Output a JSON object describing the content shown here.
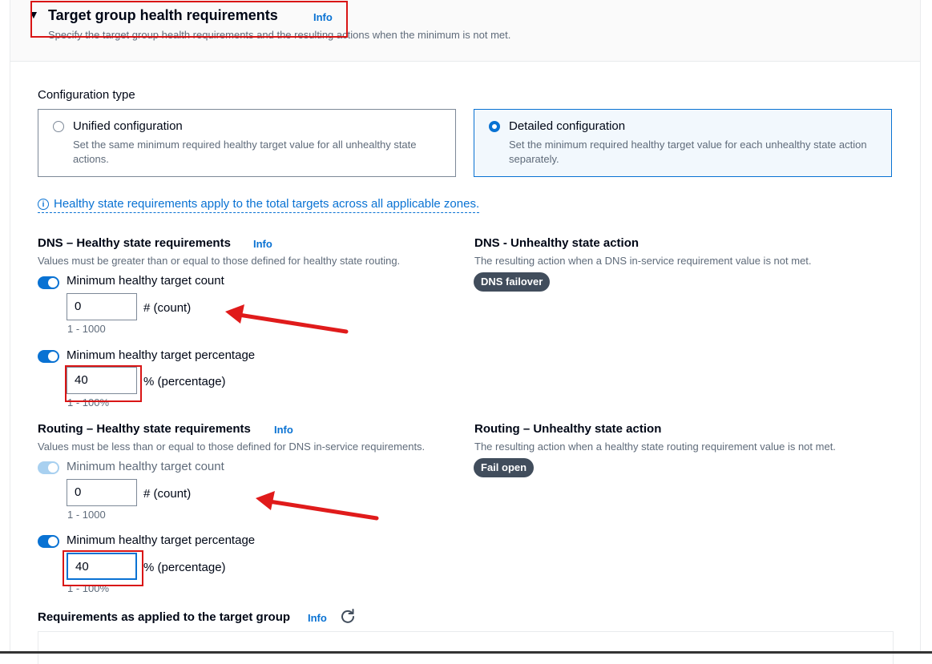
{
  "section": {
    "title": "Target group health requirements",
    "info": "Info",
    "description": "Specify the target group health requirements and the resulting actions when the minimum is not met."
  },
  "config_type": {
    "label": "Configuration type",
    "options": [
      {
        "title": "Unified configuration",
        "description": "Set the same minimum required healthy target value for all unhealthy state actions.",
        "selected": false
      },
      {
        "title": "Detailed configuration",
        "description": "Set the minimum required healthy target value for each unhealthy state action separately.",
        "selected": true
      }
    ]
  },
  "notice": "Healthy state requirements apply to the total targets across all applicable zones.",
  "dns": {
    "title": "DNS – Healthy state requirements",
    "info": "Info",
    "description": "Values must be greater than or equal to those defined for healthy state routing.",
    "count_label": "Minimum healthy target count",
    "count_value": "0",
    "count_unit": "# (count)",
    "count_constraint": "1 - 1000",
    "pct_label": "Minimum healthy target percentage",
    "pct_value": "40",
    "pct_unit": "% (percentage)",
    "pct_constraint": "1 - 100%",
    "action_title": "DNS - Unhealthy state action",
    "action_description": "The resulting action when a DNS in-service requirement value is not met.",
    "action_badge": "DNS failover"
  },
  "routing": {
    "title": "Routing – Healthy state requirements",
    "info": "Info",
    "description": "Values must be less than or equal to those defined for DNS in-service requirements.",
    "count_label": "Minimum healthy target count",
    "count_value": "0",
    "count_unit": "# (count)",
    "count_constraint": "1 - 1000",
    "pct_label": "Minimum healthy target percentage",
    "pct_value": "40",
    "pct_unit": "% (percentage)",
    "pct_constraint": "1 - 100%",
    "action_title": "Routing – Unhealthy state action",
    "action_description": "The resulting action when a healthy state routing requirement value is not met.",
    "action_badge": "Fail open"
  },
  "applied": {
    "title": "Requirements as applied to the target group",
    "info": "Info",
    "refresh_icon": "refresh-icon"
  },
  "colors": {
    "accent": "#0972d3",
    "annotation": "#d91515",
    "badge": "#414d5c"
  }
}
